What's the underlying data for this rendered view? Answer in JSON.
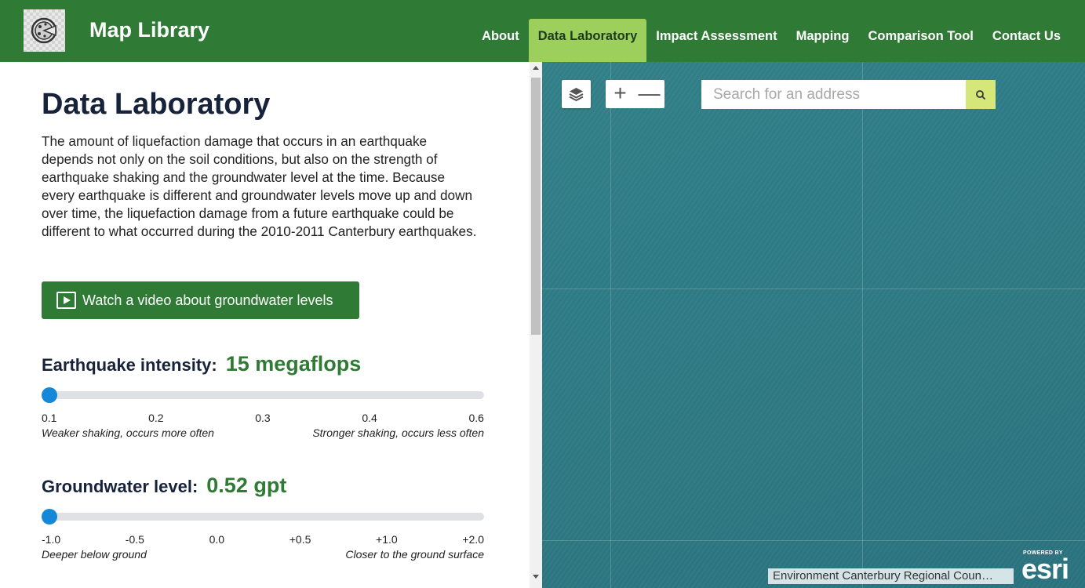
{
  "app": {
    "title": "Map Library"
  },
  "nav": {
    "items": [
      "About",
      "Data Laboratory",
      "Impact Assessment",
      "Mapping",
      "Comparison Tool",
      "Contact Us"
    ],
    "active": "Data Laboratory"
  },
  "main": {
    "title": "Data Laboratory",
    "intro": "The amount of liquefaction damage that occurs in an earthquake depends not only on the soil conditions, but also on the strength of earthquake shaking and the groundwater level at the time. Because every earthquake is different and groundwater levels move up and down over time, the liquefaction damage from a future earthquake could be different to what occurred during the 2010-2011 Canterbury earthquakes.",
    "video_button": "Watch a video about groundwater levels"
  },
  "sliders": {
    "earthquake": {
      "label": "Earthquake intensity:",
      "value_text": "15 megaflops",
      "position_fraction": 0,
      "ticks": [
        "0.1",
        "0.2",
        "0.3",
        "0.4",
        "0.6"
      ],
      "caption_left": "Weaker shaking, occurs more often",
      "caption_right": "Stronger shaking, occurs less often"
    },
    "groundwater": {
      "label": "Groundwater level:",
      "value_text": "0.52 gpt",
      "position_fraction": 0,
      "ticks": [
        "-1.0",
        "-0.5",
        "0.0",
        "+0.5",
        "+1.0",
        "+2.0"
      ],
      "caption_left": "Deeper below ground",
      "caption_right": "Closer to the ground surface"
    }
  },
  "map": {
    "search_placeholder": "Search for an address",
    "zoom_in": "+",
    "zoom_out": "—",
    "attribution": "Environment Canterbury Regional Coun…",
    "esri_powered_by": "POWERED BY",
    "esri_word": "esri"
  },
  "icons": {
    "logo": "pizza-icon",
    "layers": "layers-icon",
    "search": "search-icon",
    "play": "play-icon"
  },
  "colors": {
    "header_green": "#2f7a34",
    "active_tab": "#9ccf5b",
    "value_green": "#2f7a34",
    "slider_thumb": "#1488d8",
    "search_button": "#d6e779"
  }
}
